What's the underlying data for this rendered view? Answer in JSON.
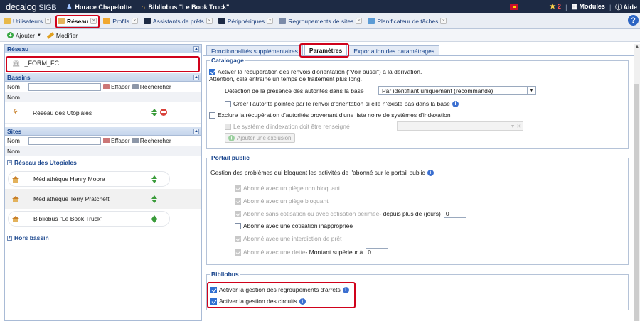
{
  "topbar": {
    "logo_main": "decalog",
    "logo_sub": " SIGB",
    "user": "Horace Chapelotte",
    "library": "Bibliobus \"Le Book Truck\"",
    "badge_count": "2",
    "modules": "Modules",
    "help": "Aide"
  },
  "tabs": [
    {
      "label": "Utilisateurs"
    },
    {
      "label": "Réseau"
    },
    {
      "label": "Profils"
    },
    {
      "label": "Assistants de prêts"
    },
    {
      "label": "Périphériques"
    },
    {
      "label": "Regroupements de sites"
    },
    {
      "label": "Planificateur de tâches"
    }
  ],
  "toolbar": {
    "add": "Ajouter",
    "edit": "Modifier"
  },
  "left": {
    "reseau_title": "Réseau",
    "reseau_item": "_FORM_FC",
    "bassins_title": "Bassins",
    "search_label": "Nom",
    "clear": "Effacer",
    "search": "Rechercher",
    "col_nom": "Nom",
    "bassin_item": "Réseau des Utopiales",
    "sites_title": "Sites",
    "group_name": "Réseau des Utopiales",
    "sites": [
      {
        "label": "Médiathèque Henry Moore"
      },
      {
        "label": "Médiathèque Terry Pratchett"
      },
      {
        "label": "Bibliobus \"Le Book Truck\""
      }
    ],
    "hors_bassin": "Hors bassin"
  },
  "right": {
    "subtabs": [
      "Fonctionnalités supplémentaires",
      "Paramètres",
      "Exportation des paramétrages"
    ],
    "catalogage": {
      "legend": "Catalogage",
      "l1": "Activer la récupération des renvois d'orientation (\"Voir aussi\") à la dérivation.",
      "l2": "Attention, cela entraine un temps de traitement plus long.",
      "detect_label": "Détection de la présence des autorités dans la base",
      "detect_value": "Par identifiant uniquement (recommandé)",
      "create_label": "Créer l'autorité pointée par le renvoi d'orientation si elle n'existe pas dans la base",
      "exclude_label": "Exclure la récupération d'autorités provenant d'une liste noire de systèmes d'indexation",
      "system_label": "Le système d'indexation doit être renseigné",
      "add_exclusion": "Ajouter une exclusion"
    },
    "portail": {
      "legend": "Portail public",
      "intro": "Gestion des problèmes qui bloquent les activités de l'abonné sur le portail public",
      "o1": "Abonné avec un piège non bloquant",
      "o2": "Abonné avec un piège bloquant",
      "o3": "Abonné sans cotisation ou avec cotisation périmée",
      "o3_suffix": " - depuis plus de (jours)",
      "o3_value": "0",
      "o4": "Abonné avec une cotisation inappropriée",
      "o5": "Abonné avec une interdiction de prêt",
      "o6": "Abonné avec une dette",
      "o6_suffix": " - Montant supérieur à",
      "o6_value": "0"
    },
    "bibliobus": {
      "legend": "Bibliobus",
      "b1": "Activer la gestion des regroupements d'arrêts",
      "b2": "Activer la gestion des circuits"
    }
  }
}
